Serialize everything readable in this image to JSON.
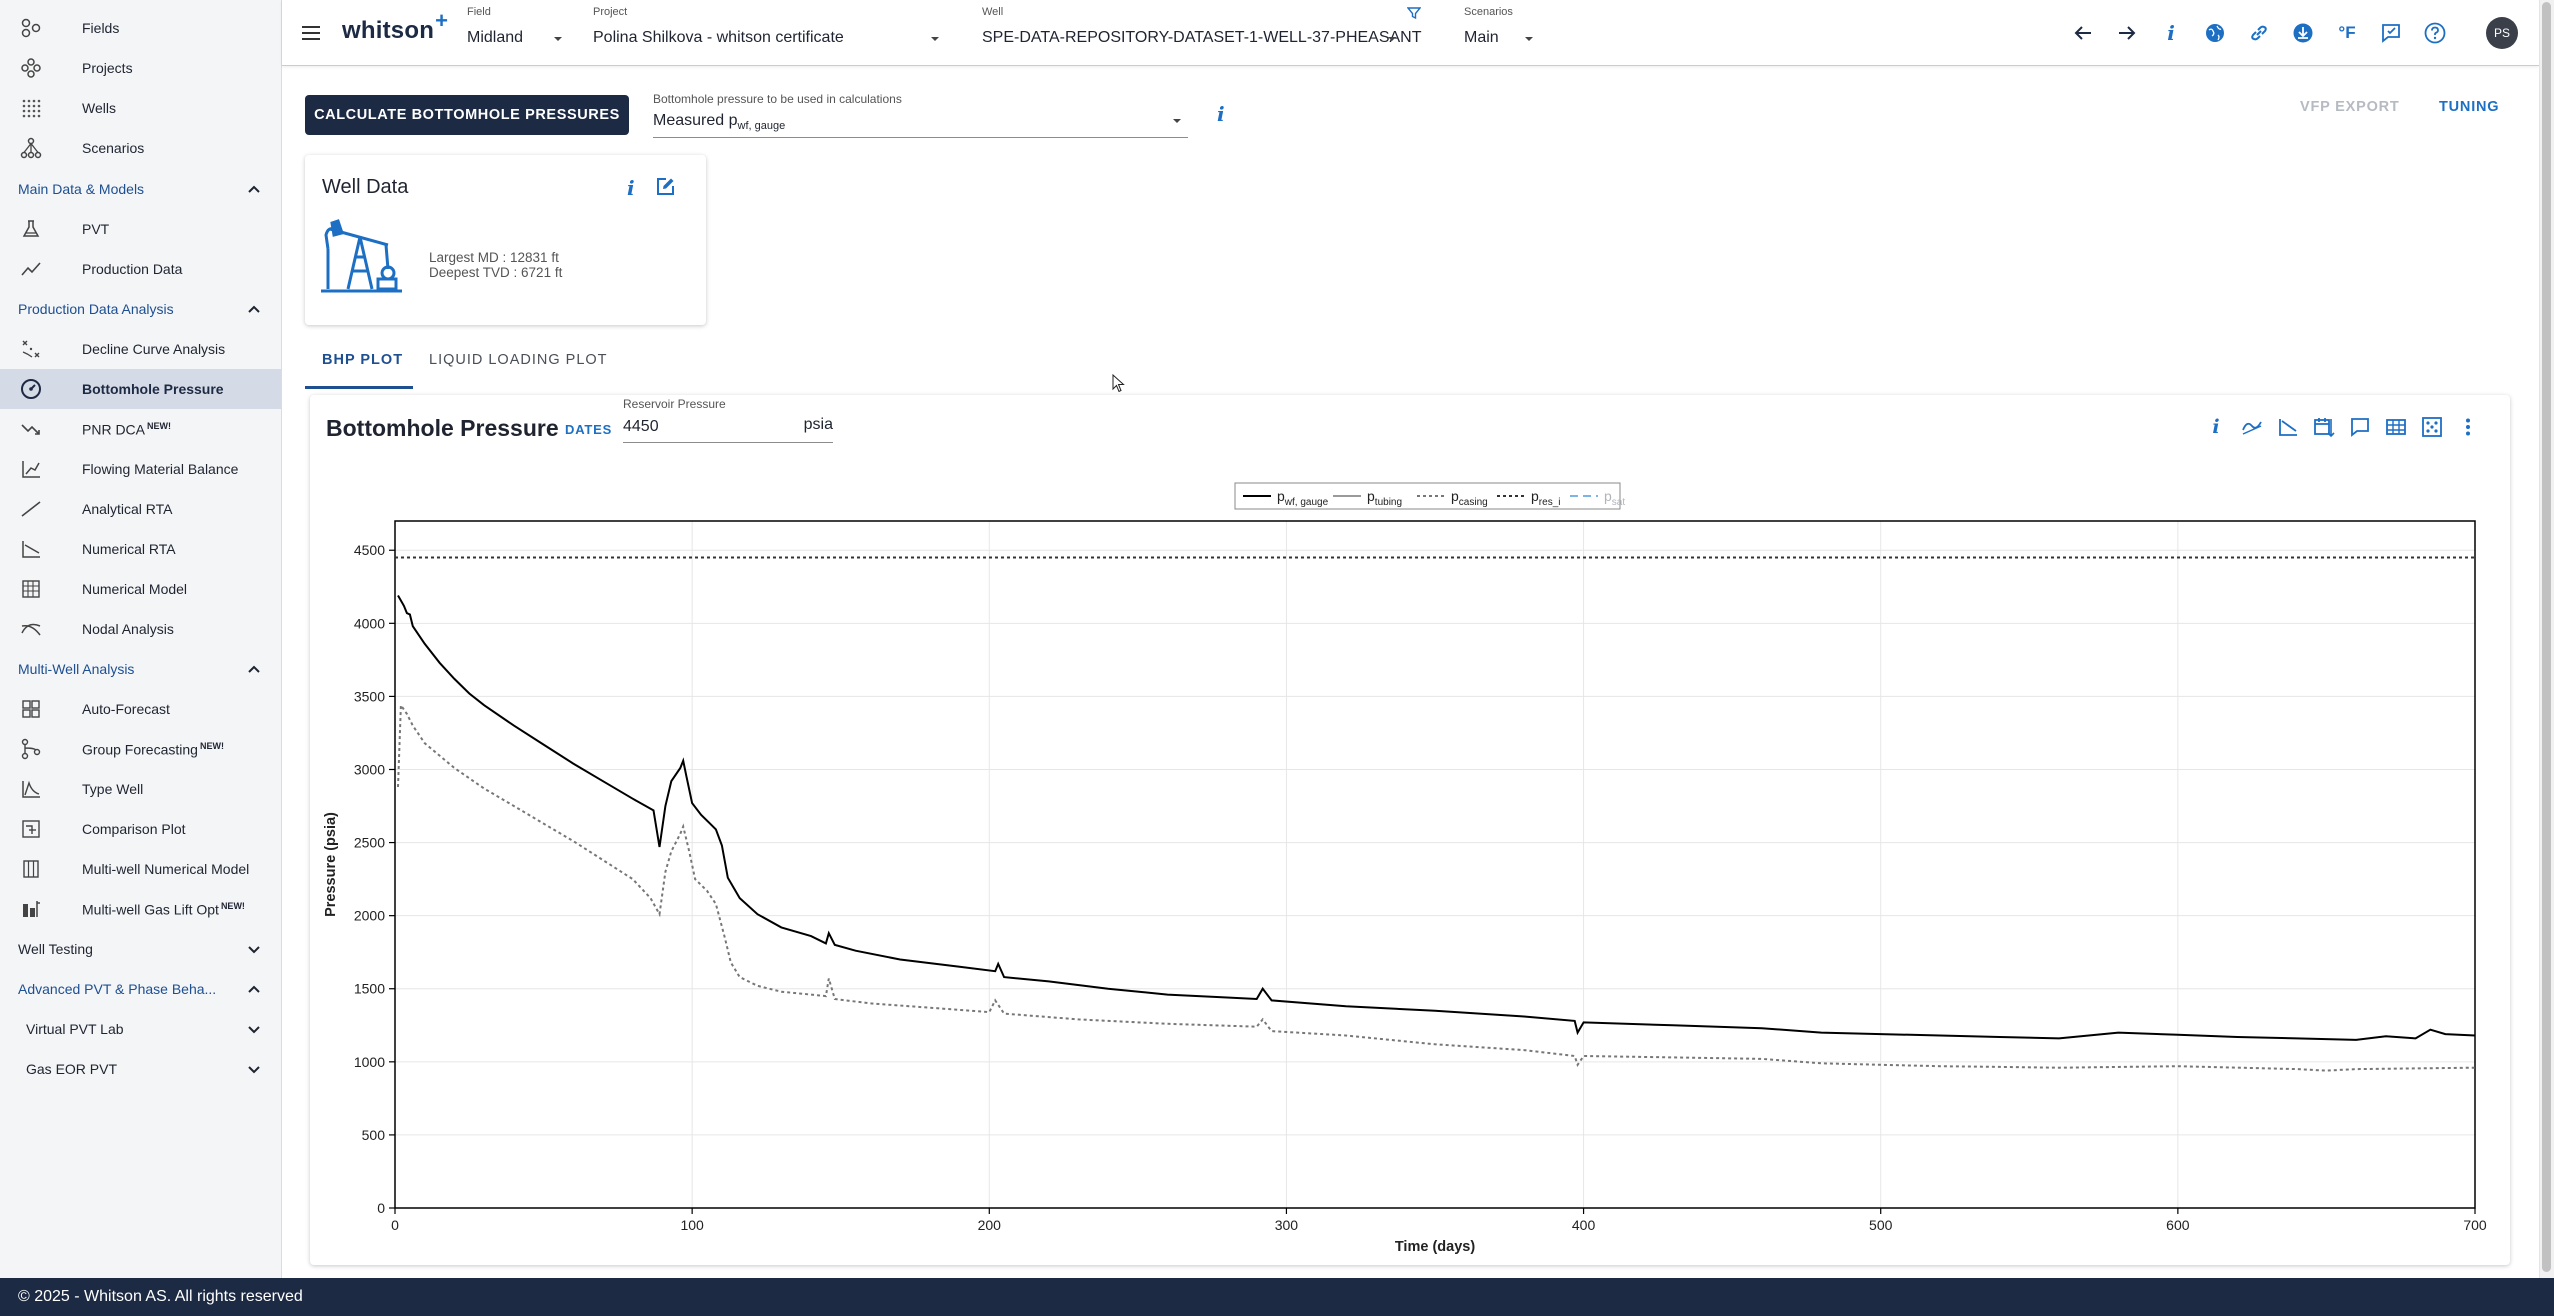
{
  "sidebar": {
    "top_items": [
      {
        "label": "Fields",
        "icon": "fields-icon"
      },
      {
        "label": "Projects",
        "icon": "projects-icon"
      },
      {
        "label": "Wells",
        "icon": "wells-icon"
      },
      {
        "label": "Scenarios",
        "icon": "scenarios-icon"
      }
    ],
    "main_data": {
      "title": "Main Data & Models",
      "items": [
        {
          "label": "PVT",
          "icon": "flask-icon"
        },
        {
          "label": "Production Data",
          "icon": "line-chart-icon"
        }
      ]
    },
    "pda": {
      "title": "Production Data Analysis",
      "items": [
        {
          "label": "Decline Curve Analysis",
          "icon": "decline-curve-icon"
        },
        {
          "label": "Bottomhole Pressure",
          "icon": "gauge-icon"
        },
        {
          "label": "PNR DCA",
          "badge": "NEW!",
          "icon": "trending-down-icon"
        },
        {
          "label": "Flowing Material Balance",
          "icon": "material-balance-icon"
        },
        {
          "label": "Analytical RTA",
          "icon": "analytical-rta-icon"
        },
        {
          "label": "Numerical RTA",
          "icon": "numerical-rta-icon"
        },
        {
          "label": "Numerical Model",
          "icon": "numerical-model-icon"
        },
        {
          "label": "Nodal Analysis",
          "icon": "nodal-analysis-icon"
        }
      ]
    },
    "multi_well": {
      "title": "Multi-Well Analysis",
      "items": [
        {
          "label": "Auto-Forecast",
          "icon": "grid-icon"
        },
        {
          "label": "Group Forecasting",
          "badge": "NEW!",
          "icon": "group-forecast-icon"
        },
        {
          "label": "Type Well",
          "icon": "type-well-icon"
        },
        {
          "label": "Comparison Plot",
          "icon": "comparison-plot-icon"
        },
        {
          "label": "Multi-well Numerical Model",
          "icon": "multi-well-model-icon"
        },
        {
          "label": "Multi-well Gas Lift Opt",
          "badge": "NEW!",
          "icon": "gas-lift-icon"
        }
      ]
    },
    "well_testing": "Well Testing",
    "advanced_pvt": "Advanced PVT & Phase Beha...",
    "virtual_pvt_lab": "Virtual PVT Lab",
    "gas_eor_pvt": "Gas EOR PVT"
  },
  "topbar": {
    "logo": "whitson",
    "logo_plus": "+",
    "field_caption": "Field",
    "field_value": "Midland",
    "project_caption": "Project",
    "project_value": "Polina Shilkova - whitson certificate",
    "well_caption": "Well",
    "well_value": "SPE-DATA-REPOSITORY-DATASET-1-WELL-37-PHEASANT",
    "scenarios_caption": "Scenarios",
    "scenarios_value": "Main",
    "unit_label": "°F",
    "avatar_initials": "PS",
    "icons": [
      "back-arrow-icon",
      "forward-arrow-icon",
      "info-icon",
      "globe-icon",
      "link-icon",
      "download-icon",
      "temperature-unit-icon",
      "feedback-icon",
      "help-icon"
    ]
  },
  "main": {
    "calc_button": "CALCULATE BOTTOMHOLE PRESSURES",
    "bhp_select_caption": "Bottomhole pressure to be used in calculations",
    "bhp_select_value_main": "Measured p",
    "bhp_select_value_sub": "wf, gauge",
    "vfp_export": "VFP EXPORT",
    "tuning": "TUNING",
    "info_glyph": "i"
  },
  "well_card": {
    "title": "Well Data",
    "largest_md": "Largest MD :  12831 ft",
    "deepest_tvd": "Deepest TVD :  6721 ft"
  },
  "tabs": [
    {
      "label": "BHP PLOT",
      "active": true
    },
    {
      "label": "LIQUID LOADING PLOT",
      "active": false
    }
  ],
  "plot": {
    "title": "Bottomhole Pressure",
    "dates_button": "DATES",
    "reservoir_pressure_caption": "Reservoir Pressure",
    "reservoir_pressure_value": "4450",
    "reservoir_pressure_unit": "psia",
    "toolbar_icons": [
      "info-icon",
      "curve-fit-icon",
      "slope-icon",
      "calendar-edit-icon",
      "comment-icon",
      "table-icon",
      "scatter-icon",
      "more-vert-icon"
    ]
  },
  "footer": {
    "text": "© 2025 - Whitson AS. All rights reserved"
  },
  "chart_data": {
    "type": "line",
    "title": "",
    "xlabel": "Time (days)",
    "ylabel": "Pressure (psia)",
    "xlim": [
      0,
      700
    ],
    "ylim": [
      0,
      4700
    ],
    "x_ticks": [
      0,
      100,
      200,
      300,
      400,
      500,
      600,
      700
    ],
    "y_ticks": [
      0,
      500,
      1000,
      1500,
      2000,
      2500,
      3000,
      3500,
      4000,
      4500
    ],
    "grid": true,
    "legend_position": "top-center",
    "legend": [
      {
        "main": "p",
        "sub": "wf, gauge",
        "style": "solid",
        "color": "#000000"
      },
      {
        "main": "p",
        "sub": "tubing",
        "style": "solid",
        "color": "#9a9a9a"
      },
      {
        "main": "p",
        "sub": "casing",
        "style": "dotted",
        "color": "#777777"
      },
      {
        "main": "p",
        "sub": "res_i",
        "style": "dotted",
        "color": "#333333"
      },
      {
        "main": "p",
        "sub": "sat",
        "style": "dashed",
        "color": "#7db3e6",
        "faded": true
      }
    ],
    "series": [
      {
        "name": "pwf, gauge",
        "color": "#000000",
        "style": "solid",
        "points": [
          [
            1,
            4190
          ],
          [
            3,
            4120
          ],
          [
            4,
            4070
          ],
          [
            5,
            4060
          ],
          [
            6,
            3980
          ],
          [
            10,
            3860
          ],
          [
            15,
            3730
          ],
          [
            20,
            3620
          ],
          [
            25,
            3520
          ],
          [
            30,
            3440
          ],
          [
            40,
            3300
          ],
          [
            50,
            3170
          ],
          [
            60,
            3040
          ],
          [
            70,
            2920
          ],
          [
            80,
            2800
          ],
          [
            87,
            2720
          ],
          [
            89,
            2470
          ],
          [
            91,
            2750
          ],
          [
            93,
            2920
          ],
          [
            96,
            3010
          ],
          [
            97,
            3060
          ],
          [
            98,
            2960
          ],
          [
            100,
            2770
          ],
          [
            103,
            2690
          ],
          [
            106,
            2630
          ],
          [
            108,
            2590
          ],
          [
            110,
            2480
          ],
          [
            112,
            2260
          ],
          [
            116,
            2120
          ],
          [
            122,
            2010
          ],
          [
            130,
            1920
          ],
          [
            140,
            1860
          ],
          [
            145,
            1810
          ],
          [
            146,
            1880
          ],
          [
            148,
            1800
          ],
          [
            155,
            1760
          ],
          [
            170,
            1700
          ],
          [
            190,
            1650
          ],
          [
            202,
            1620
          ],
          [
            203,
            1670
          ],
          [
            205,
            1580
          ],
          [
            220,
            1550
          ],
          [
            240,
            1500
          ],
          [
            260,
            1460
          ],
          [
            280,
            1440
          ],
          [
            290,
            1430
          ],
          [
            292,
            1500
          ],
          [
            295,
            1420
          ],
          [
            320,
            1380
          ],
          [
            350,
            1350
          ],
          [
            380,
            1310
          ],
          [
            397,
            1280
          ],
          [
            398,
            1200
          ],
          [
            400,
            1270
          ],
          [
            430,
            1250
          ],
          [
            460,
            1230
          ],
          [
            480,
            1200
          ],
          [
            500,
            1190
          ],
          [
            520,
            1180
          ],
          [
            540,
            1170
          ],
          [
            560,
            1160
          ],
          [
            580,
            1200
          ],
          [
            600,
            1185
          ],
          [
            620,
            1170
          ],
          [
            640,
            1160
          ],
          [
            660,
            1150
          ],
          [
            670,
            1175
          ],
          [
            680,
            1160
          ],
          [
            685,
            1220
          ],
          [
            690,
            1190
          ],
          [
            700,
            1180
          ]
        ]
      },
      {
        "name": "pcasing",
        "color": "#777777",
        "style": "dotted",
        "points": [
          [
            1,
            2880
          ],
          [
            2,
            3440
          ],
          [
            4,
            3380
          ],
          [
            6,
            3300
          ],
          [
            10,
            3180
          ],
          [
            20,
            3010
          ],
          [
            30,
            2870
          ],
          [
            40,
            2750
          ],
          [
            50,
            2630
          ],
          [
            60,
            2510
          ],
          [
            70,
            2380
          ],
          [
            80,
            2250
          ],
          [
            86,
            2120
          ],
          [
            89,
            2010
          ],
          [
            91,
            2300
          ],
          [
            93,
            2440
          ],
          [
            96,
            2560
          ],
          [
            97,
            2610
          ],
          [
            99,
            2440
          ],
          [
            101,
            2250
          ],
          [
            105,
            2170
          ],
          [
            108,
            2080
          ],
          [
            111,
            1850
          ],
          [
            113,
            1680
          ],
          [
            116,
            1580
          ],
          [
            122,
            1520
          ],
          [
            130,
            1480
          ],
          [
            140,
            1460
          ],
          [
            145,
            1450
          ],
          [
            146,
            1570
          ],
          [
            148,
            1430
          ],
          [
            160,
            1400
          ],
          [
            180,
            1370
          ],
          [
            200,
            1340
          ],
          [
            202,
            1420
          ],
          [
            205,
            1330
          ],
          [
            230,
            1290
          ],
          [
            260,
            1260
          ],
          [
            290,
            1240
          ],
          [
            292,
            1290
          ],
          [
            295,
            1210
          ],
          [
            320,
            1180
          ],
          [
            350,
            1120
          ],
          [
            380,
            1080
          ],
          [
            397,
            1040
          ],
          [
            398,
            980
          ],
          [
            400,
            1040
          ],
          [
            430,
            1030
          ],
          [
            460,
            1020
          ],
          [
            480,
            990
          ],
          [
            500,
            980
          ],
          [
            520,
            970
          ],
          [
            540,
            965
          ],
          [
            560,
            960
          ],
          [
            600,
            970
          ],
          [
            640,
            950
          ],
          [
            650,
            940
          ],
          [
            660,
            950
          ],
          [
            700,
            960
          ]
        ]
      },
      {
        "name": "pres_i",
        "color": "#333333",
        "style": "dotted",
        "points": [
          [
            0,
            4450
          ],
          [
            700,
            4450
          ]
        ]
      }
    ]
  }
}
